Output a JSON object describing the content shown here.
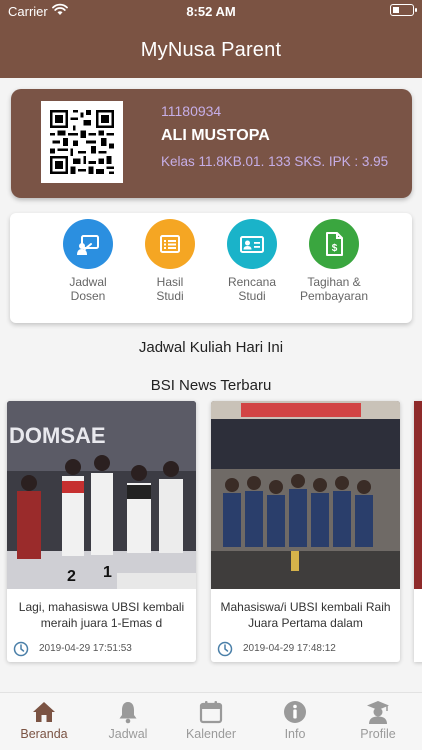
{
  "status_bar": {
    "carrier": "Carrier",
    "time": "8:52 AM"
  },
  "header": {
    "title": "MyNusa Parent"
  },
  "student": {
    "id": "11180934",
    "name": "ALI MUSTOPA",
    "details": "Kelas 11.8KB.01. 133 SKS. IPK : 3.95"
  },
  "menu": {
    "items": [
      {
        "label_line1": "Jadwal",
        "label_line2": "Dosen",
        "color": "#2b8fe0",
        "icon": "teacher-board-icon"
      },
      {
        "label_line1": "Hasil",
        "label_line2": "Studi",
        "color": "#f5a623",
        "icon": "list-icon"
      },
      {
        "label_line1": "Rencana",
        "label_line2": "Studi",
        "color": "#1ab3c9",
        "icon": "id-card-icon"
      },
      {
        "label_line1": "Tagihan &",
        "label_line2": "Pembayaran",
        "color": "#3aa63f",
        "icon": "invoice-icon"
      }
    ]
  },
  "sections": {
    "schedule_title": "Jadwal Kuliah Hari Ini",
    "news_title": "BSI News Terbaru"
  },
  "news": [
    {
      "caption": "Lagi, mahasiswa UBSI kembali meraih juara 1-Emas d",
      "date": "2019-04-29 17:51:53",
      "photo_text": "DOMSAE"
    },
    {
      "caption": "Mahasiswa/i UBSI kembali Raih Juara Pertama dalam",
      "date": "2019-04-29 17:48:12"
    }
  ],
  "tabs": [
    {
      "label": "Beranda",
      "icon": "home-icon",
      "active": true
    },
    {
      "label": "Jadwal",
      "icon": "bell-icon",
      "active": false
    },
    {
      "label": "Kalender",
      "icon": "calendar-icon",
      "active": false
    },
    {
      "label": "Info",
      "icon": "info-icon",
      "active": false
    },
    {
      "label": "Profile",
      "icon": "graduate-icon",
      "active": false
    }
  ],
  "colors": {
    "brand": "#7b5343",
    "accent_text": "#c6aee6",
    "tab_inactive": "#9a9a9a"
  }
}
